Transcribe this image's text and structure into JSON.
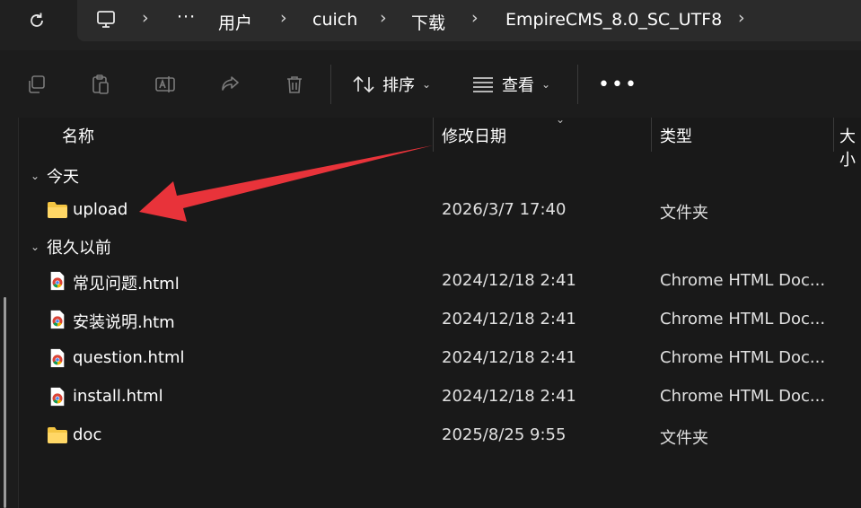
{
  "address_bar": {
    "crumbs": [
      "用户",
      "cuich",
      "下载",
      "EmpireCMS_8.0_SC_UTF8"
    ],
    "ellipsis": "···"
  },
  "toolbar": {
    "sort_label": "排序",
    "view_label": "查看",
    "more_label": "•••"
  },
  "columns": {
    "name": "名称",
    "date": "修改日期",
    "type": "类型",
    "size": "大小"
  },
  "groups": [
    {
      "label": "今天",
      "items": [
        {
          "name": "upload",
          "date": "2026/3/7 17:40",
          "type": "文件夹",
          "icon": "folder-icon"
        }
      ]
    },
    {
      "label": "很久以前",
      "items": [
        {
          "name": "常见问题.html",
          "date": "2024/12/18 2:41",
          "type": "Chrome HTML Doc...",
          "icon": "chrome-html-icon"
        },
        {
          "name": "安装说明.htm",
          "date": "2024/12/18 2:41",
          "type": "Chrome HTML Doc...",
          "icon": "chrome-html-icon"
        },
        {
          "name": "question.html",
          "date": "2024/12/18 2:41",
          "type": "Chrome HTML Doc...",
          "icon": "chrome-html-icon"
        },
        {
          "name": "install.html",
          "date": "2024/12/18 2:41",
          "type": "Chrome HTML Doc...",
          "icon": "chrome-html-icon"
        },
        {
          "name": "doc",
          "date": "2025/8/25 9:55",
          "type": "文件夹",
          "icon": "folder-icon"
        }
      ]
    }
  ],
  "colors": {
    "background": "#191919",
    "folder": "#f4c542",
    "annotation_arrow": "#e8333a"
  }
}
